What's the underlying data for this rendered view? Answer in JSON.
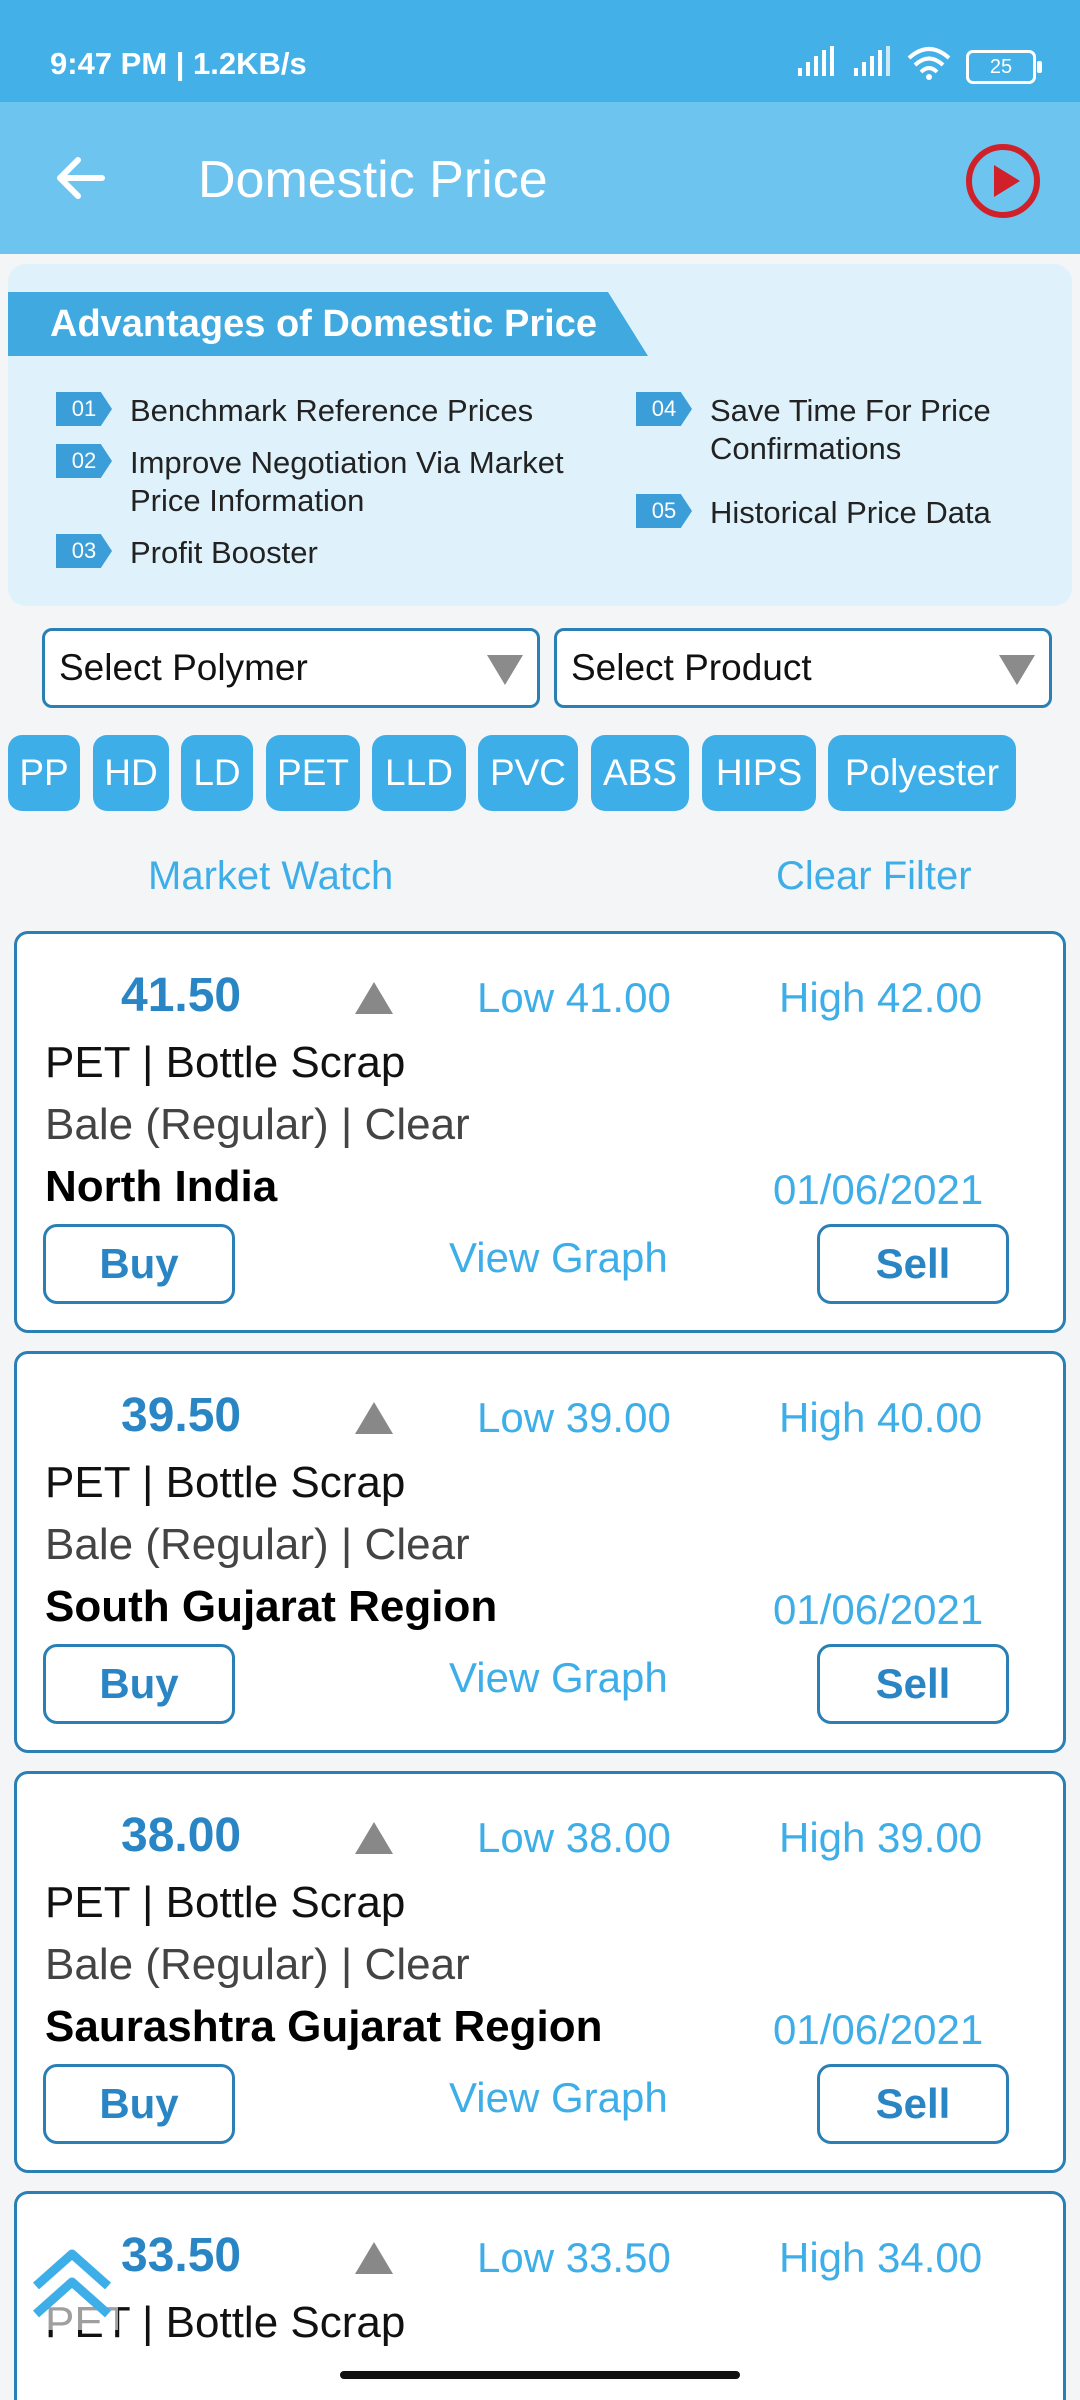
{
  "status": {
    "time": "9:47 PM | 1.2KB/s",
    "battery": "25"
  },
  "appbar": {
    "title": "Domestic Price",
    "back_icon": "arrow-left-icon",
    "play_icon": "play-circle-icon"
  },
  "banner": {
    "heading": "Advantages of Domestic Price",
    "items": [
      {
        "num": "01",
        "text": "Benchmark Reference Prices"
      },
      {
        "num": "02",
        "text": "Improve Negotiation Via Market\nPrice Information"
      },
      {
        "num": "03",
        "text": "Profit Booster"
      },
      {
        "num": "04",
        "text": "Save Time For Price\nConfirmations"
      },
      {
        "num": "05",
        "text": "Historical Price Data"
      }
    ]
  },
  "filters": {
    "polymer": "Select Polymer",
    "product": "Select Product"
  },
  "chips": [
    "PP",
    "HD",
    "LD",
    "PET",
    "LLD",
    "PVC",
    "ABS",
    "HIPS",
    "Polyester"
  ],
  "market": {
    "title": "Market Watch",
    "clear": "Clear Filter"
  },
  "cards": [
    {
      "price": "41.50",
      "low": "Low 41.00",
      "high": "High 42.00",
      "product": "PET | Bottle Scrap",
      "grade": "Bale (Regular) | Clear",
      "region": "North India",
      "date": "01/06/2021",
      "buy": "Buy",
      "graph": "View Graph",
      "sell": "Sell"
    },
    {
      "price": "39.50",
      "low": "Low 39.00",
      "high": "High 40.00",
      "product": "PET | Bottle Scrap",
      "grade": "Bale (Regular) | Clear",
      "region": "South Gujarat Region",
      "date": "01/06/2021",
      "buy": "Buy",
      "graph": "View Graph",
      "sell": "Sell"
    },
    {
      "price": "38.00",
      "low": "Low 38.00",
      "high": "High 39.00",
      "product": "PET | Bottle Scrap",
      "grade": "Bale (Regular) | Clear",
      "region": "Saurashtra Gujarat Region",
      "date": "01/06/2021",
      "buy": "Buy",
      "graph": "View Graph",
      "sell": "Sell"
    },
    {
      "price": "33.50",
      "low": "Low 33.50",
      "high": "High 34.00",
      "product": "PET | Bottle Scrap",
      "grade": "",
      "region": "",
      "date": "",
      "buy": "",
      "graph": "",
      "sell": ""
    }
  ]
}
